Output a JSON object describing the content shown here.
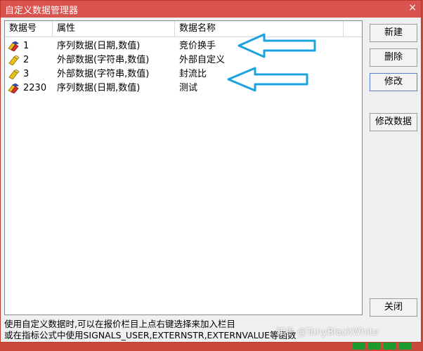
{
  "window": {
    "title": "自定义数据管理器",
    "close_glyph": "×"
  },
  "table": {
    "headers": [
      "数据号",
      "属性",
      "数据名称",
      ""
    ],
    "rows": [
      {
        "id": "1",
        "attribute": "序列数据(日期,数值)",
        "name": "竞价换手",
        "icon": "sequence-data-icon"
      },
      {
        "id": "2",
        "attribute": "外部数据(字符串,数值)",
        "name": "外部自定义",
        "icon": "external-data-icon"
      },
      {
        "id": "3",
        "attribute": "外部数据(字符串,数值)",
        "name": "封流比",
        "icon": "external-data-icon"
      },
      {
        "id": "2230",
        "attribute": "序列数据(日期,数值)",
        "name": "测试",
        "icon": "sequence-data-icon"
      }
    ]
  },
  "buttons": {
    "new": "新建",
    "delete": "删除",
    "modify": "修改",
    "modify_data": "修改数据",
    "close": "关闭"
  },
  "status": {
    "line1": "使用自定义数据时,可以在报价栏目上点右键选择来加入栏目",
    "line2": "或在指标公式中使用SIGNALS_USER,EXTERNSTR,EXTERNVALUE等函数"
  },
  "watermark": "知乎 @TonyBlackWhite",
  "colors": {
    "titlebar": "#d9534f",
    "arrow": "#1aa3e0",
    "icon_yellow": "#e8c21a",
    "icon_blue": "#3a5bd9",
    "icon_red": "#d6322b"
  }
}
